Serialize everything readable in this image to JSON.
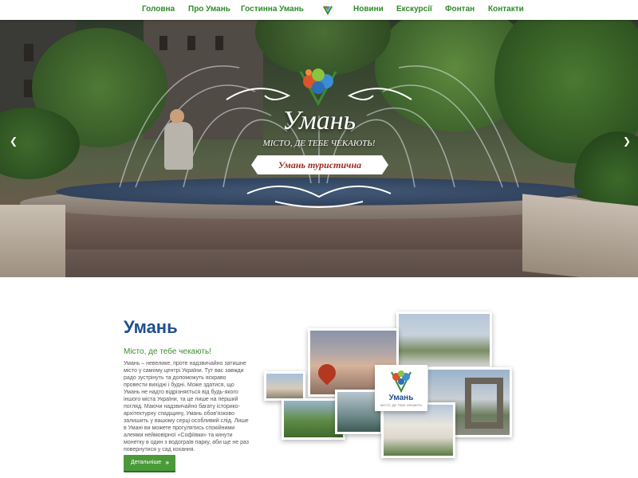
{
  "nav": {
    "items": [
      {
        "label": "Головна"
      },
      {
        "label": "Про Умань"
      },
      {
        "label": "Гостинна Умань"
      },
      {
        "label": "Новини"
      },
      {
        "label": "Екскурсії"
      },
      {
        "label": "Фонтан"
      },
      {
        "label": "Контакти"
      }
    ],
    "logo_icon": "uman-tree-logo-icon"
  },
  "hero": {
    "title": "Умань",
    "subtitle": "МІСТО, ДЕ ТЕБЕ ЧЕКАЮТЬ!",
    "ribbon": "Умань туристична",
    "prev_icon": "chevron-left-icon",
    "next_icon": "chevron-right-icon"
  },
  "about": {
    "title": "Умань",
    "subtitle": "Місто, де тебе чекають!",
    "text": "Умань – невелике, проте надзвичайно затишне місто у самому центрі України. Тут вас завжди радо зустрінуть та допоможуть яскраво провести вихідні і будні. Може здатися, що Умань не надто відрізняється від будь-якого іншого міста України, та це лише на перший погляд. Маючи надзвичайно багату історико-архітектурну спадщину, Умань обов'язково залишить у вашому серці особливий слід. Лише в Умані ви можете прогулятись спокійними алеями неймовірної «Софіївки» та кинути монетку в один з водограїв парку, аби ще не раз повернутися у сад кохання.",
    "button_label": "Детальніше",
    "button_icon": "double-chevron-right-icon"
  },
  "logo_card": {
    "name": "Умань",
    "tagline": "МІСТО, ДЕ ТЕБЕ ЧЕКАЮТЬ"
  },
  "colors": {
    "nav_text": "#2f8a2a",
    "title_blue": "#1f4f8f",
    "subtitle_green": "#3c8c2e",
    "button_green": "#4b9a3a",
    "ribbon_text": "#9a2a1e"
  }
}
